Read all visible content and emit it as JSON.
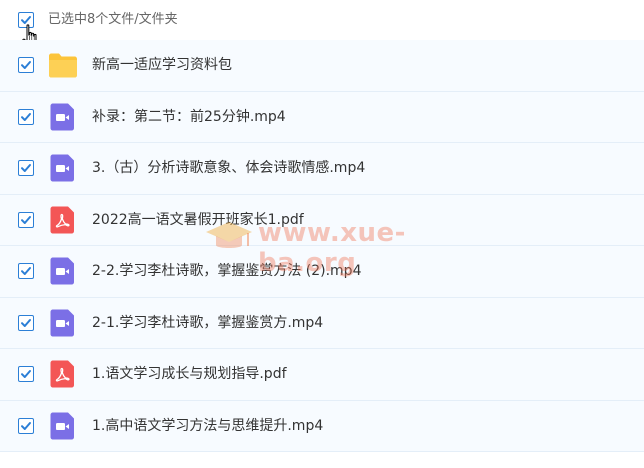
{
  "header": {
    "selection_text": "已选中8个文件/文件夹",
    "select_all_checked": true
  },
  "icons": {
    "folder": "folder-icon",
    "video": "video-file-icon",
    "pdf": "pdf-file-icon",
    "check": "checkmark-icon",
    "cursor": "hand-pointer-cursor-icon"
  },
  "colors": {
    "checkbox": "#2c7fd6",
    "folder": "#fcc43a",
    "video": "#7b6fe6",
    "pdf": "#f35656",
    "row_background": "#f7fbff"
  },
  "files": [
    {
      "name": "新高一适应学习资料包",
      "type": "folder",
      "checked": true
    },
    {
      "name": "补录：第二节：前25分钟.mp4",
      "type": "video",
      "checked": true
    },
    {
      "name": "3.（古）分析诗歌意象、体会诗歌情感.mp4",
      "type": "video",
      "checked": true
    },
    {
      "name": "2022高一语文暑假开班家长1.pdf",
      "type": "pdf",
      "checked": true
    },
    {
      "name": "2-2.学习李杜诗歌，掌握鉴赏方法 (2).mp4",
      "type": "video",
      "checked": true
    },
    {
      "name": "2-1.学习李杜诗歌，掌握鉴赏方.mp4",
      "type": "video",
      "checked": true
    },
    {
      "name": "1.语文学习成长与规划指导.pdf",
      "type": "pdf",
      "checked": true
    },
    {
      "name": "1.高中语文学习方法与思维提升.mp4",
      "type": "video",
      "checked": true
    }
  ],
  "watermark": {
    "text": "www.xue-ba.org"
  }
}
